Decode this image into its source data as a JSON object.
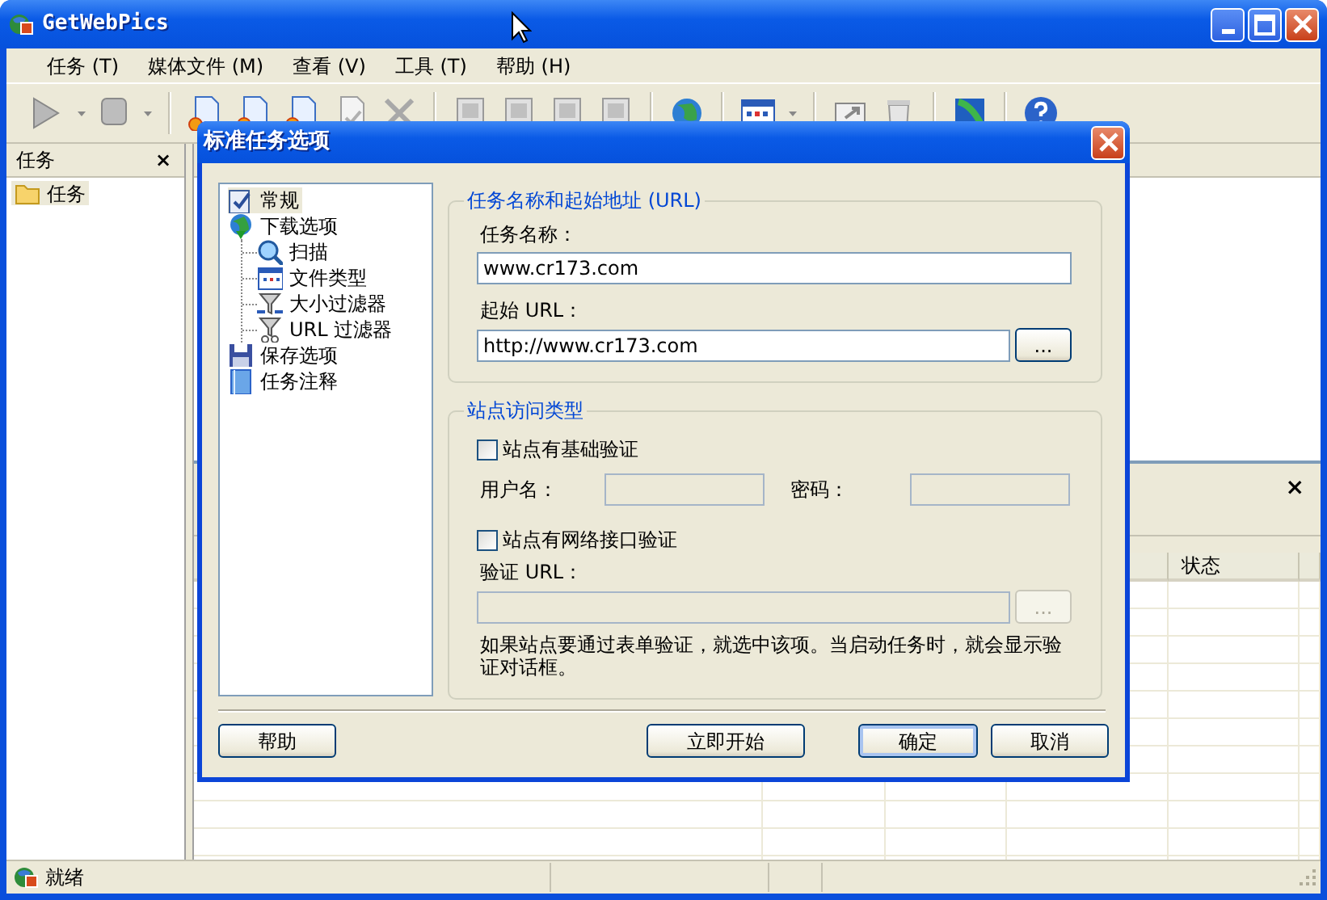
{
  "window": {
    "title": "GetWebPics"
  },
  "menu": [
    {
      "label": "任务 (T)"
    },
    {
      "label": "媒体文件 (M)"
    },
    {
      "label": "查看 (V)"
    },
    {
      "label": "工具 (T)"
    },
    {
      "label": "帮助 (H)"
    }
  ],
  "task_panel": {
    "title": "任务",
    "close": "×",
    "tree": [
      {
        "label": "任务",
        "selected": true
      }
    ]
  },
  "lower_panel": {
    "close": "×",
    "columns": [
      {
        "label": "状态"
      }
    ]
  },
  "status_bar": {
    "text": "就绪"
  },
  "dialog": {
    "title": "标准任务选项",
    "tree": [
      {
        "label": "常规",
        "selected": true
      },
      {
        "label": "下载选项",
        "selected": false,
        "children": [
          {
            "label": "扫描",
            "selected": false
          },
          {
            "label": "文件类型",
            "selected": false
          },
          {
            "label": "大小过滤器",
            "selected": false
          },
          {
            "label": "URL 过滤器",
            "selected": false
          }
        ]
      },
      {
        "label": "保存选项",
        "selected": false
      },
      {
        "label": "任务注释",
        "selected": false
      }
    ],
    "name_group": {
      "title": "任务名称和起始地址 (URL)",
      "task_name_label": "任务名称：",
      "task_name": {
        "value": "www.cr173.com",
        "disabled": false
      },
      "start_url_label": "起始 URL：",
      "start_url": {
        "value": "http://www.cr173.com",
        "disabled": false
      },
      "browse": {
        "label": "...",
        "disabled": false
      }
    },
    "access_group": {
      "title": "站点访问类型",
      "basic_auth": {
        "label": "站点有基础验证",
        "checked": false
      },
      "username_label": "用户名：",
      "username": {
        "disabled": true
      },
      "password_label": "密码：",
      "password": {
        "disabled": true
      },
      "web_auth": {
        "label": "站点有网络接口验证",
        "checked": false
      },
      "verify_url_label": "验证 URL：",
      "verify_url": {
        "disabled": true
      },
      "browse": {
        "label": "...",
        "disabled": true
      },
      "note": "如果站点要通过表单验证，就选中该项。当启动任务时，就会显示验证对话框。"
    },
    "buttons": [
      {
        "label": "帮助",
        "default": false
      },
      {
        "label": "立即开始",
        "default": false
      },
      {
        "label": "确定",
        "default": true
      },
      {
        "label": "取消",
        "default": false
      }
    ]
  }
}
